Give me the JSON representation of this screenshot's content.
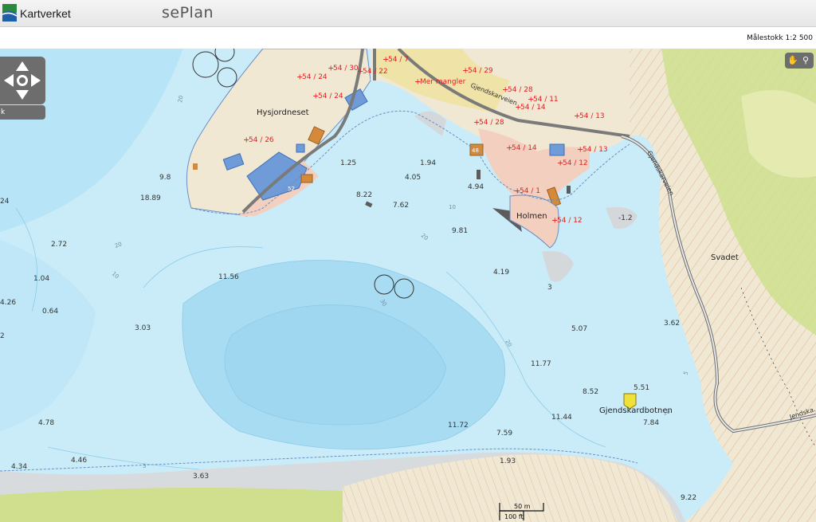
{
  "header": {
    "brand": "Kartverket",
    "app_title": "sePlan",
    "scale": "Målestokk 1:2 500"
  },
  "controls": {
    "zoom_label": "k",
    "pan_icon": "pan-arrows-icon",
    "hand_icon": "hand-icon",
    "magnifier_icon": "magnifier-icon"
  },
  "map": {
    "place_names": [
      "Hysjordneset",
      "Holmen",
      "Svadet",
      "Gjendskardbotnen"
    ],
    "road_names": [
      "Gjendskarveien",
      "Jendska..."
    ],
    "parcel_labels": [
      "54 / 7",
      "54 / 24",
      "54 / 30",
      "54 / 22",
      "54 / 29",
      "Mer mangler",
      "54 / 24",
      "54 / 26",
      "54 / 28",
      "54 / 11",
      "54 / 14",
      "54 / 13",
      "54 / 28",
      "54 / 14",
      "54 / 13",
      "54 / 12",
      "54 / 1",
      "54 / 12"
    ],
    "building_numbers": [
      "52",
      "48"
    ],
    "depth_soundings": [
      "9.8",
      "18.89",
      "1.25",
      "8.22",
      "1.94",
      "4.05",
      "7.62",
      "4.94",
      "9.81",
      "-1.2",
      "2.72",
      "1.04",
      "4.26",
      "0.64",
      "11.56",
      "3.03",
      "4.19",
      "3",
      "5.07",
      "3.62",
      "11.77",
      "8.52",
      "5.51",
      "11.44",
      "7.84",
      "11.72",
      "7.59",
      "1.93",
      "4.78",
      "4.34",
      "4.46",
      "3.63",
      "9.22",
      "24",
      "2"
    ],
    "contour_labels": [
      "20",
      "10",
      "20",
      "10",
      "20",
      "10",
      "5",
      "5",
      "30",
      "20",
      "10"
    ],
    "scalebar": {
      "metric": "50 m",
      "imperial": "100 ft"
    },
    "colors": {
      "water_deep": "#a8dcf3",
      "water_shallow": "#c9ecf8",
      "land": "#f1e8d4",
      "forest": "#cfdf8e",
      "buildings": "#6f9bd8",
      "parcel_label": "#e02020",
      "contour": "#c98a55"
    }
  }
}
